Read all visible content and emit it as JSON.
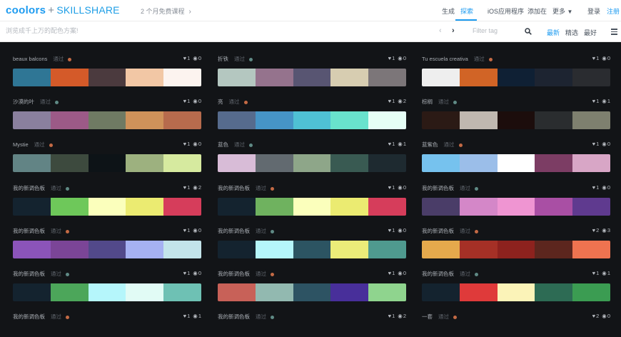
{
  "brand": {
    "name": "coolors",
    "plus": "+",
    "partner": "SKILLSHARE"
  },
  "promo": {
    "text": "2 个月免费课程",
    "chevron": "›"
  },
  "nav": [
    {
      "label": "生成",
      "active": false
    },
    {
      "label": "探索",
      "active": true
    },
    {
      "label": "iOS应用程序",
      "active": false
    },
    {
      "label": "添加在",
      "active": false
    },
    {
      "label": "更多",
      "active": false
    },
    {
      "label": "登录",
      "active": false
    },
    {
      "label": "注册",
      "active": true
    }
  ],
  "search": {
    "placeholder": "浏览成千上万的配色方案!",
    "prev": "‹",
    "next": "›",
    "filter_placeholder": "Filter tag"
  },
  "sort_options": [
    {
      "label": "最新",
      "active": true
    },
    {
      "label": "精选",
      "active": false
    },
    {
      "label": "最好",
      "active": false
    }
  ],
  "palettes": [
    {
      "name": "beaux balcons",
      "sub": "通过",
      "likes": "1",
      "views": "0",
      "colors": [
        "#2f7695",
        "#d45a29",
        "#4b3a3e",
        "#f2c7a5",
        "#fcf3ef"
      ]
    },
    {
      "name": "折铁",
      "sub": "通过",
      "likes": "1",
      "views": "0",
      "colors": [
        "#b4c7c0",
        "#95738d",
        "#585572",
        "#d7cdb1",
        "#7c7679"
      ]
    },
    {
      "name": "Tu escuela creativa",
      "sub": "通过",
      "likes": "1",
      "views": "0",
      "colors": [
        "#eeeeee",
        "#d16426",
        "#0f2034",
        "#1d2431",
        "#2a2c30"
      ]
    },
    {
      "name": "沙漠的叶",
      "sub": "通过",
      "likes": "1",
      "views": "0",
      "colors": [
        "#8a809e",
        "#9c5a87",
        "#6f7a63",
        "#cf925a",
        "#b76b4d"
      ]
    },
    {
      "name": "亮",
      "sub": "通过",
      "likes": "1",
      "views": "2",
      "colors": [
        "#566b8d",
        "#4694c6",
        "#4fc1d4",
        "#69e2cd",
        "#e6fff6"
      ]
    },
    {
      "name": "棕榈",
      "sub": "通过",
      "likes": "1",
      "views": "1",
      "colors": [
        "#2b1a15",
        "#c0b8b0",
        "#1c0d0c",
        "#2a2d2f",
        "#7e806f"
      ]
    },
    {
      "name": "Mystie",
      "sub": "通过",
      "likes": "1",
      "views": "0",
      "colors": [
        "#628485",
        "#3d4a3e",
        "#0d1317",
        "#9db17f",
        "#d6ea9f"
      ]
    },
    {
      "name": "蓝色",
      "sub": "通过",
      "likes": "1",
      "views": "1",
      "colors": [
        "#d8bcd7",
        "#626a70",
        "#8ea689",
        "#395a52",
        "#1e2a30"
      ]
    },
    {
      "name": "蓝紫色",
      "sub": "通过",
      "likes": "1",
      "views": "0",
      "colors": [
        "#76c2ee",
        "#9bbee9",
        "#ffffff",
        "#7c3d64",
        "#d8a6c6"
      ]
    },
    {
      "name": "我的新调色板",
      "sub": "通过",
      "likes": "1",
      "views": "2",
      "colors": [
        "#14232f",
        "#6ec85a",
        "#fbffbc",
        "#ebeb71",
        "#d63d5b"
      ]
    },
    {
      "name": "我的新调色板",
      "sub": "通过",
      "likes": "1",
      "views": "0",
      "colors": [
        "#14232f",
        "#6fb25f",
        "#fbffbc",
        "#ebeb71",
        "#d63d5b"
      ]
    },
    {
      "name": "我的新调色板",
      "sub": "通过",
      "likes": "1",
      "views": "0",
      "colors": [
        "#4a3d68",
        "#d487c8",
        "#ef95d2",
        "#a94fa4",
        "#5f3a8f"
      ]
    },
    {
      "name": "我的新调色板",
      "sub": "通过",
      "likes": "1",
      "views": "0",
      "colors": [
        "#8b54b9",
        "#7b4597",
        "#52498a",
        "#a6b1f2",
        "#c3e4ea"
      ]
    },
    {
      "name": "我的新调色板",
      "sub": "通过",
      "likes": "1",
      "views": "0",
      "colors": [
        "#14232f",
        "#b5f6fb",
        "#2c5462",
        "#ebec79",
        "#4f9a8f"
      ]
    },
    {
      "name": "我的新调色板",
      "sub": "通过",
      "likes": "2",
      "views": "3",
      "colors": [
        "#e5a94c",
        "#a53026",
        "#8d221e",
        "#5c261e",
        "#ef7350"
      ]
    },
    {
      "name": "我的新调色板",
      "sub": "通过",
      "likes": "1",
      "views": "0",
      "colors": [
        "#14232f",
        "#4ca65a",
        "#b5f6fb",
        "#e1fbf5",
        "#6ec1b4"
      ]
    },
    {
      "name": "我的新调色板",
      "sub": "通过",
      "likes": "1",
      "views": "0",
      "colors": [
        "#c86158",
        "#92b9b0",
        "#2d5363",
        "#482f9a",
        "#8fd48e"
      ]
    },
    {
      "name": "我的新调色板",
      "sub": "通过",
      "likes": "1",
      "views": "1",
      "colors": [
        "#14232f",
        "#df3a3a",
        "#fbf3b8",
        "#2d6b54",
        "#3b9c52"
      ]
    },
    {
      "name": "我的新调色板",
      "sub": "通过",
      "likes": "1",
      "views": "1",
      "colors": []
    },
    {
      "name": "我的新调色板",
      "sub": "通过",
      "likes": "1",
      "views": "2",
      "colors": []
    },
    {
      "name": "一套",
      "sub": "通过",
      "likes": "2",
      "views": "0",
      "colors": []
    }
  ],
  "colors": {
    "accent": "#1d9bf0",
    "background": "#121417",
    "dot_orange": "#c46a45",
    "dot_teal": "#5f8a85"
  }
}
